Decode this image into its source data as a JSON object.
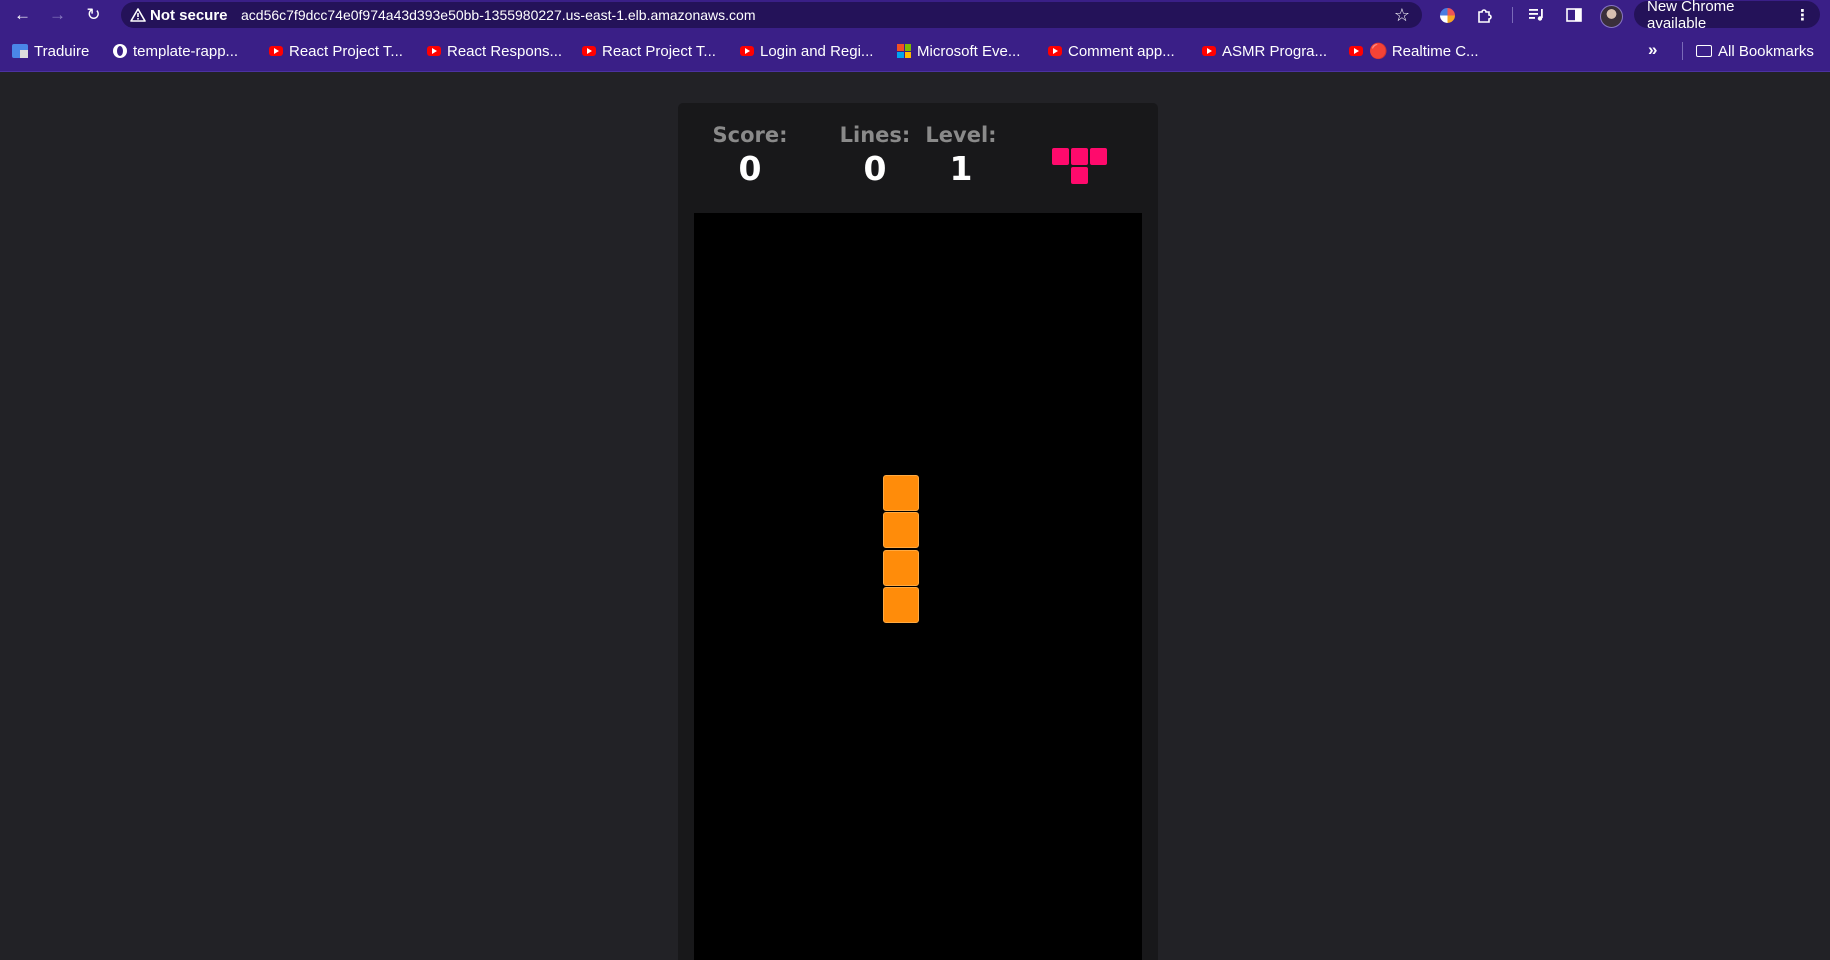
{
  "browser": {
    "nav": {
      "back_icon": "arrow-left-icon",
      "forward_icon": "arrow-right-icon",
      "reload_icon": "reload-icon"
    },
    "security_label": "Not secure",
    "url": "acd56c7f9dcc74e0f974a43d393e50bb-1355980227.us-east-1.elb.amazonaws.com",
    "update_label": "New Chrome available",
    "bookmarks": [
      {
        "label": "Traduire",
        "icon": "google-translate-icon"
      },
      {
        "label": "template-rapp...",
        "icon": "globe-icon"
      },
      {
        "label": "React Project T...",
        "icon": "youtube-icon"
      },
      {
        "label": "React Respons...",
        "icon": "youtube-icon"
      },
      {
        "label": "React Project T...",
        "icon": "youtube-icon"
      },
      {
        "label": "Login and Regi...",
        "icon": "youtube-icon"
      },
      {
        "label": "Microsoft Eve...",
        "icon": "microsoft-icon"
      },
      {
        "label": "Comment app...",
        "icon": "youtube-icon"
      },
      {
        "label": "ASMR Progra...",
        "icon": "youtube-icon"
      },
      {
        "label": "🔴 Realtime C...",
        "icon": "youtube-icon"
      }
    ],
    "all_bookmarks_label": "All Bookmarks",
    "colors": {
      "chrome_bg": "#3a1f87",
      "omnibox_bg": "#241259"
    }
  },
  "game": {
    "score_label": "Score:",
    "score": "0",
    "lines_label": "Lines:",
    "lines": "0",
    "level_label": "Level:",
    "level": "1",
    "next_piece": {
      "shape": "T",
      "color": "#ff0a6c"
    },
    "board": {
      "columns": 12,
      "rows": 20
    },
    "active_piece": {
      "shape": "I",
      "orientation": "vertical",
      "color": "#ff8c0a",
      "cells": [
        [
          5,
          7
        ],
        [
          5,
          8
        ],
        [
          5,
          9
        ],
        [
          5,
          10
        ]
      ]
    },
    "colors": {
      "page_bg": "#222226",
      "panel_bg": "#18181a",
      "board_bg": "#000000"
    }
  }
}
